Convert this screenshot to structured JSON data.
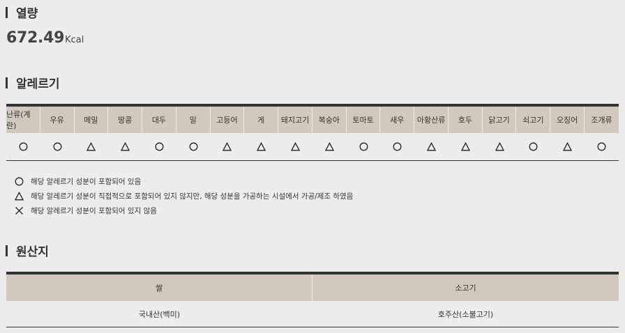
{
  "calorie": {
    "title": "열량",
    "value": "672.49",
    "unit": "Kcal"
  },
  "allergy": {
    "title": "알레르기",
    "columns": [
      {
        "name": "난류(계란)",
        "mark": "circle"
      },
      {
        "name": "우유",
        "mark": "circle"
      },
      {
        "name": "메밀",
        "mark": "triangle"
      },
      {
        "name": "땅콩",
        "mark": "triangle"
      },
      {
        "name": "대두",
        "mark": "circle"
      },
      {
        "name": "밀",
        "mark": "circle"
      },
      {
        "name": "고등어",
        "mark": "triangle"
      },
      {
        "name": "게",
        "mark": "triangle"
      },
      {
        "name": "돼지고기",
        "mark": "triangle"
      },
      {
        "name": "복숭아",
        "mark": "triangle"
      },
      {
        "name": "토마토",
        "mark": "circle"
      },
      {
        "name": "새우",
        "mark": "circle"
      },
      {
        "name": "아황산류",
        "mark": "triangle"
      },
      {
        "name": "호두",
        "mark": "triangle"
      },
      {
        "name": "닭고기",
        "mark": "triangle"
      },
      {
        "name": "쇠고기",
        "mark": "circle"
      },
      {
        "name": "오징어",
        "mark": "triangle"
      },
      {
        "name": "조개류",
        "mark": "circle"
      }
    ],
    "legend": [
      {
        "mark": "circle",
        "text": "해당 알레르기 성분이 포함되어 있음"
      },
      {
        "mark": "triangle",
        "text": "해당 알레르기 성분이 직접적으로 포함되어 있지 않지만, 해당 성분을 가공하는 시설에서 가공/제조 하였음"
      },
      {
        "mark": "cross",
        "text": "해당 알레르기 성분이 포함되어 있지 않음"
      }
    ]
  },
  "origin": {
    "title": "원산지",
    "headers": [
      "쌀",
      "소고기"
    ],
    "values": [
      "국내산(백미)",
      "호주산(소불고기)"
    ]
  }
}
